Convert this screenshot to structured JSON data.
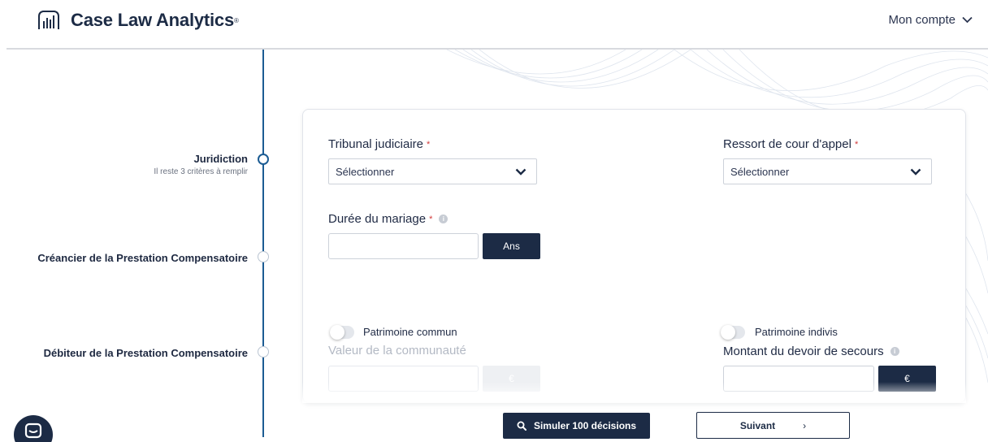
{
  "header": {
    "brand": "Case Law Analytics",
    "brand_mark": "®",
    "account_label": "Mon compte",
    "account_icon": "chevron-down-icon"
  },
  "stepper": {
    "steps": [
      {
        "title": "Juridiction",
        "subtitle": "Il reste 3 critères à remplir",
        "state": "active"
      },
      {
        "title": "Créancier de la Prestation Compensatoire",
        "subtitle": "",
        "state": "idle"
      },
      {
        "title": "Débiteur de la Prestation Compensatoire",
        "subtitle": "",
        "state": "idle"
      }
    ]
  },
  "form": {
    "tribunal": {
      "label": "Tribunal judiciaire",
      "required": "*",
      "value": "Sélectionner"
    },
    "ressort": {
      "label": "Ressort de cour d'appel",
      "required": "*",
      "value": "Sélectionner"
    },
    "duree": {
      "label": "Durée du mariage",
      "required": "*",
      "unit": "Ans",
      "value": ""
    },
    "patrimoine_commun": {
      "label": "Patrimoine commun",
      "on": false
    },
    "patrimoine_indivis": {
      "label": "Patrimoine indivis",
      "on": false
    },
    "valeur_communaute": {
      "label": "Valeur de la communauté",
      "unit": "€"
    },
    "devoir_secours": {
      "label": "Montant du devoir de secours",
      "unit": "€"
    }
  },
  "actions": {
    "simulate_label": "Simuler 100 décisions",
    "next_label": "Suivant",
    "next_chevron": "›"
  },
  "colors": {
    "navy": "#1c2b45",
    "accent_blue": "#1c5c93",
    "required_red": "#d23a3a"
  }
}
